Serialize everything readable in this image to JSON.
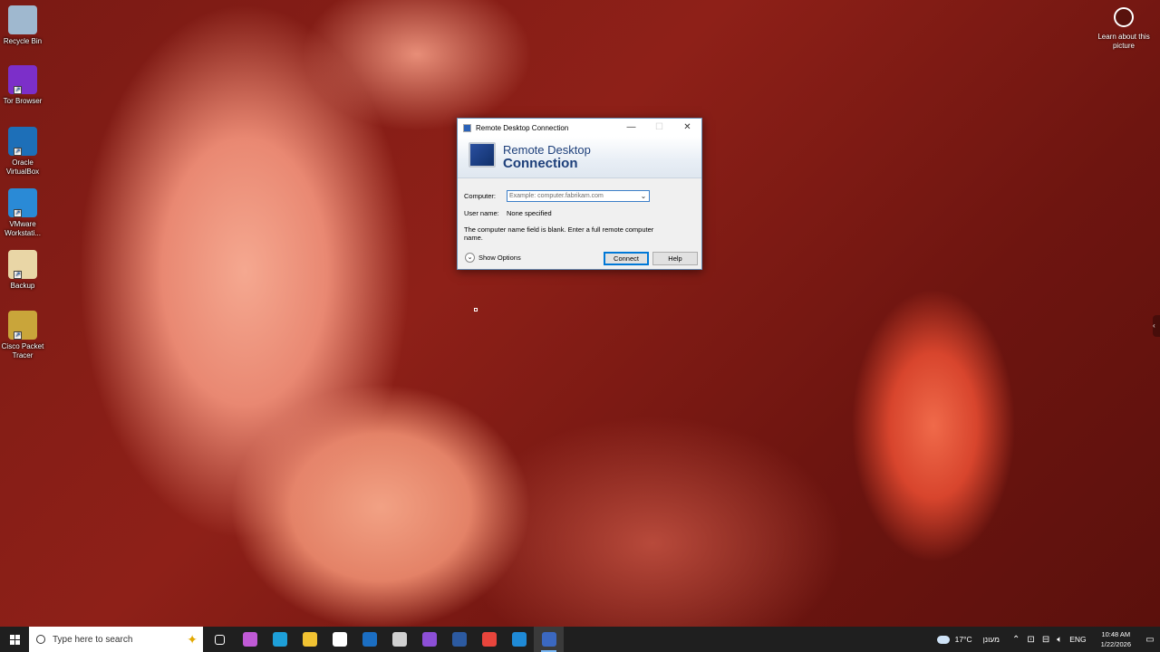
{
  "desktop": {
    "icons": [
      {
        "label": "Recycle Bin",
        "icon": "recycle-bin-icon",
        "color": "#9fb8cf"
      },
      {
        "label": "Tor Browser",
        "icon": "tor-browser-icon",
        "color": "#7c2fc9"
      },
      {
        "label": "Oracle VirtualBox",
        "icon": "virtualbox-icon",
        "color": "#1d6fb8"
      },
      {
        "label": "VMware Workstati...",
        "icon": "vmware-icon",
        "color": "#2a8ad6"
      },
      {
        "label": "Backup",
        "icon": "backup-icon",
        "color": "#e9d6a6"
      },
      {
        "label": "Cisco Packet Tracer",
        "icon": "packet-tracer-icon",
        "color": "#c9a53a"
      }
    ],
    "learn_about": "Learn about this picture"
  },
  "dialog": {
    "title": "Remote Desktop Connection",
    "banner_line1": "Remote Desktop",
    "banner_line2": "Connection",
    "computer_label": "Computer:",
    "computer_placeholder": "Example: computer.fabrikam.com",
    "username_label": "User name:",
    "username_value": "None specified",
    "message": "The computer name field is blank.  Enter a full remote computer name.",
    "show_options": "Show Options",
    "connect": "Connect",
    "help": "Help"
  },
  "taskbar": {
    "search_placeholder": "Type here to search",
    "apps": [
      {
        "icon": "task-view-icon",
        "color": "#ffffff"
      },
      {
        "icon": "copilot-icon",
        "color": "#c05ad6"
      },
      {
        "icon": "edge-icon",
        "color": "#1e9fd8"
      },
      {
        "icon": "file-explorer-icon",
        "color": "#f1c232"
      },
      {
        "icon": "store-icon",
        "color": "#ffffff"
      },
      {
        "icon": "outlook-icon",
        "color": "#1b6ec2"
      },
      {
        "icon": "snipping-icon",
        "color": "#d0d0d0"
      },
      {
        "icon": "visual-studio-icon",
        "color": "#8c4fd6"
      },
      {
        "icon": "powershell-icon",
        "color": "#2c5aa0"
      },
      {
        "icon": "chrome-icon",
        "color": "#e8453c"
      },
      {
        "icon": "vscode-icon",
        "color": "#1f8ad6"
      },
      {
        "icon": "remote-desktop-icon",
        "color": "#3b68c0"
      }
    ],
    "weather_temp": "17°C",
    "weather_text": "מעונן",
    "language": "ENG",
    "time": "10:48 AM",
    "date": "1/22/2026"
  }
}
